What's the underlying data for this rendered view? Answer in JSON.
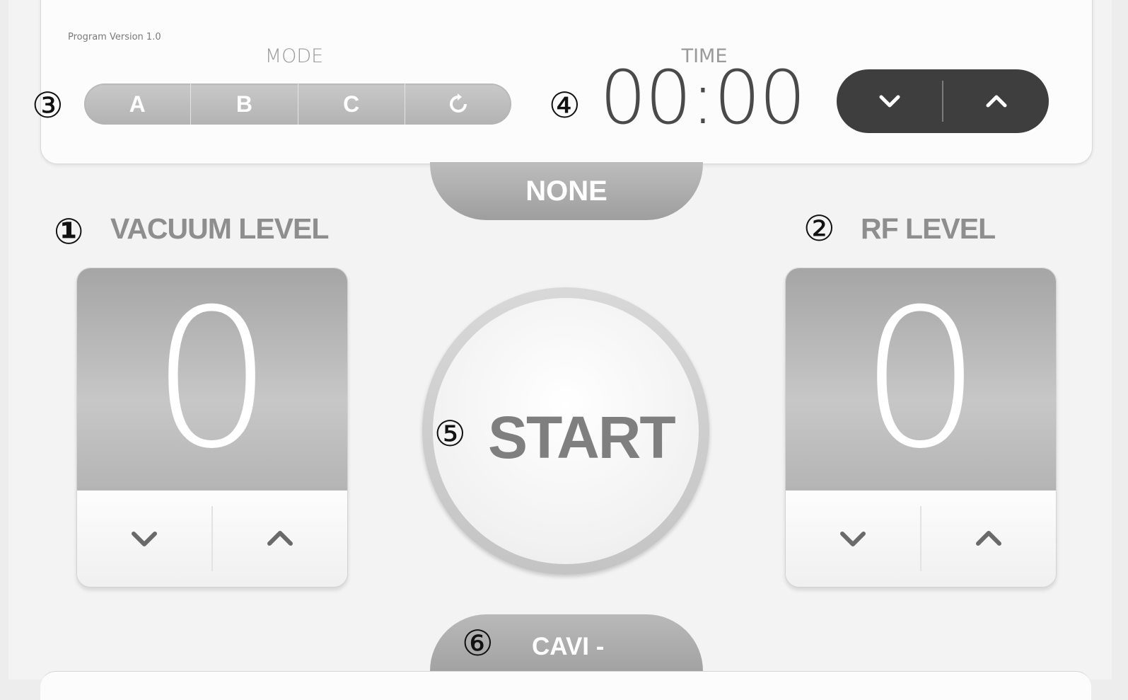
{
  "header": {
    "program_version": "Program Version 1.0",
    "mode_label": "MODE",
    "time_label": "TIME",
    "time_value": "00:00"
  },
  "mode": {
    "options": [
      "A",
      "B",
      "C",
      "↻"
    ]
  },
  "markers": {
    "vacuum": "①",
    "rf": "②",
    "mode": "③",
    "time": "④",
    "start": "⑤",
    "cavi": "⑥"
  },
  "tabs": {
    "top": "NONE",
    "bottom": "CAVI -"
  },
  "vacuum": {
    "title": "VACUUM LEVEL",
    "value": "0"
  },
  "rf": {
    "title": "RF LEVEL",
    "value": "0"
  },
  "start_label": "START",
  "icons": {
    "down": "chevron-down-icon",
    "up": "chevron-up-icon",
    "mode_cycle": "cycle-icon"
  },
  "colors": {
    "dark_control": "#3e3e3e",
    "grey_panel": "#b3b3b3",
    "text_grey": "#8e8e8e"
  }
}
